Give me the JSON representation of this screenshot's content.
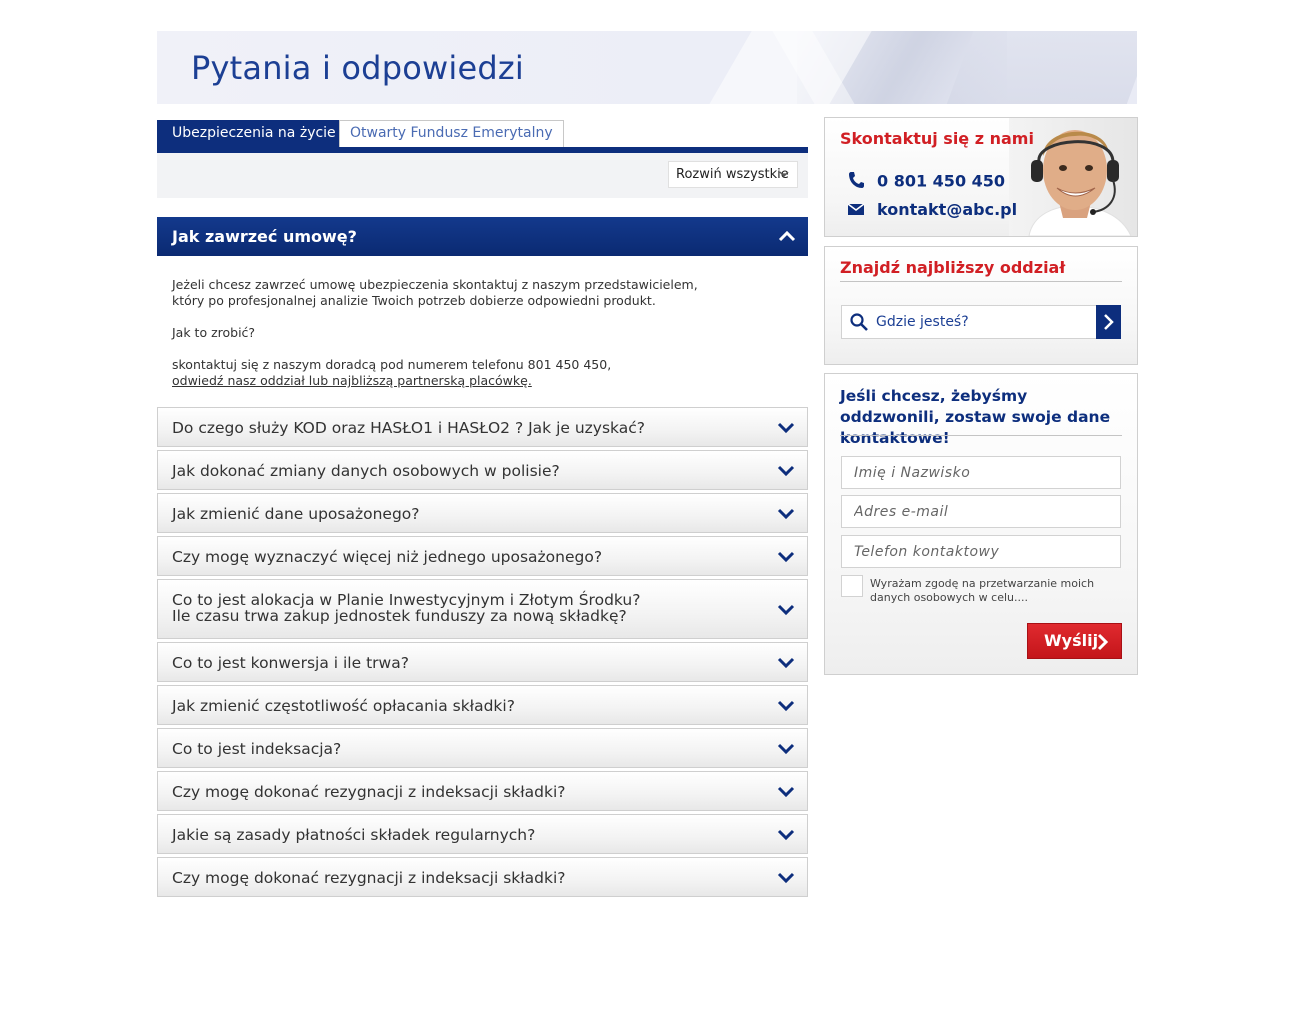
{
  "header": {
    "title": "Pytania i odpowiedzi"
  },
  "tabs": [
    {
      "label": "Ubezpieczenia na życie",
      "active": true
    },
    {
      "label": "Otwarty Fundusz Emerytalny",
      "active": false
    }
  ],
  "toolbar": {
    "expand_all": "Rozwiń wszystkie"
  },
  "faq_open": {
    "question": "Jak zawrzeć umowę?",
    "answer_p1_line1": "Jeżeli chcesz zawrzeć umowę ubezpieczenia skontaktuj z naszym przedstawicielem,",
    "answer_p1_line2": "który po profesjonalnej analizie Twoich potrzeb dobierze odpowiedni produkt.",
    "answer_p2": "Jak to zrobić?",
    "answer_p3": "skontaktuj się z naszym doradcą pod numerem telefonu 801 450 450,",
    "answer_link": "odwiedź nasz oddział lub najbliższą partnerską placówkę."
  },
  "faq_items": [
    "Do czego służy KOD oraz HASŁO1 i HASŁO2 ? Jak je uzyskać?",
    "Jak dokonać zmiany danych osobowych w polisie?",
    "Jak zmienić dane uposażonego?",
    "Czy mogę wyznaczyć więcej niż jednego uposażonego?",
    "Co to jest alokacja w Planie Inwestycyjnym i Złotym Środku?",
    "Co to jest konwersja i ile trwa?",
    "Jak zmienić częstotliwość opłacania składki?",
    "Co to jest indeksacja?",
    "Czy mogę dokonać rezygnacji z indeksacji składki?",
    "Jakie są zasady płatności składek regularnych?",
    "Czy mogę dokonać rezygnacji z indeksacji składki?"
  ],
  "faq_item5_line2": "Ile czasu trwa zakup jednostek funduszy za nową składkę?",
  "contact": {
    "title": "Skontaktuj się z nami",
    "phone": "0 801 450 450",
    "email": "kontakt@abc.pl"
  },
  "find_branch": {
    "title": "Znajdź najbliższy oddział",
    "placeholder": "Gdzie jesteś?"
  },
  "callback": {
    "title": "Jeśli chcesz, żebyśmy oddzwonili, zostaw swoje dane kontaktowe!",
    "name_placeholder": "Imię i Nazwisko",
    "email_placeholder": "Adres e-mail",
    "phone_placeholder": "Telefon kontaktowy",
    "consent": "Wyrażam zgodę na przetwarzanie moich danych osobowych w celu....",
    "send": "Wyślij"
  },
  "colors": {
    "navy": "#0d2e7d",
    "title_blue": "#1c3f94",
    "red": "#d11f24"
  }
}
